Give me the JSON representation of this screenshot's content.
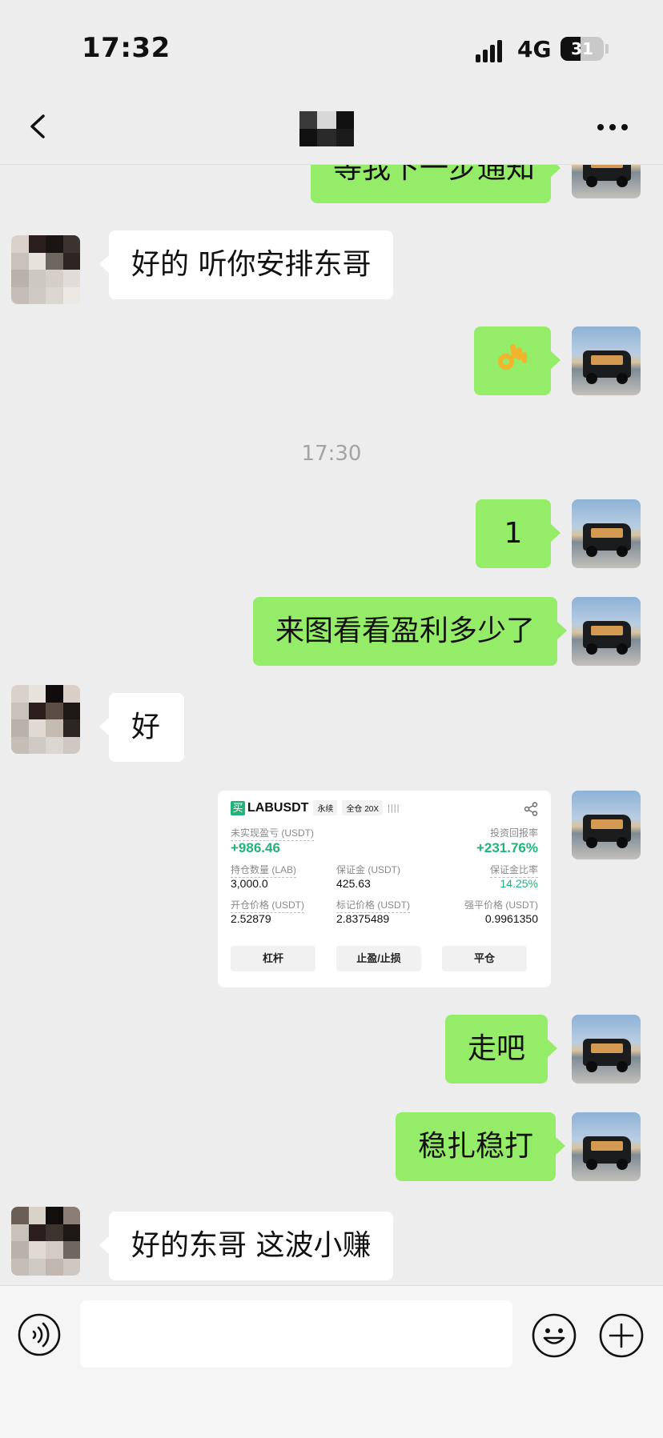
{
  "status_bar": {
    "time": "17:32",
    "network": "4G",
    "battery": "31"
  },
  "nav": {
    "back_label": "<",
    "more_label": "..."
  },
  "messages": {
    "m0": "等我下一步通知",
    "m1": "好的 听你安排东哥",
    "m3": "1",
    "m4": "来图看看盈利多少了",
    "m5": "好",
    "m7": "走吧",
    "m8": "稳扎稳打",
    "m9": "好的东哥 这波小赚"
  },
  "timestamp": "17:30",
  "trade_card": {
    "buy_tag": "买",
    "symbol": "LABUSDT",
    "tag_perpetual": "永续",
    "tag_margin": "全仓 20X",
    "bars": "||||",
    "pnl_label": "未实现盈亏 (USDT)",
    "pnl_value": "+986.46",
    "roi_label": "投资回报率",
    "roi_value": "+231.76%",
    "qty_label": "持仓数量 (LAB)",
    "qty_value": "3,000.0",
    "margin_label": "保证金 (USDT)",
    "margin_value": "425.63",
    "margin_ratio_label": "保证金比率",
    "margin_ratio_value": "14.25%",
    "entry_label": "开仓价格 (USDT)",
    "entry_value": "2.52879",
    "mark_label": "标记价格 (USDT)",
    "mark_value": "2.8375489",
    "liq_label": "强平价格 (USDT)",
    "liq_value": "0.9961350",
    "btn_leverage": "杠杆",
    "btn_tpsl": "止盈/止损",
    "btn_close": "平仓"
  },
  "input": {
    "placeholder": ""
  },
  "colors": {
    "bubble_out": "#95ec69",
    "bubble_in": "#ffffff",
    "background": "#ededed",
    "profit_green": "#23b37a"
  },
  "icons": [
    "back-icon",
    "more-icon",
    "ok-hand-emoji",
    "share-icon",
    "voice-icon",
    "emoji-icon",
    "plus-icon"
  ]
}
